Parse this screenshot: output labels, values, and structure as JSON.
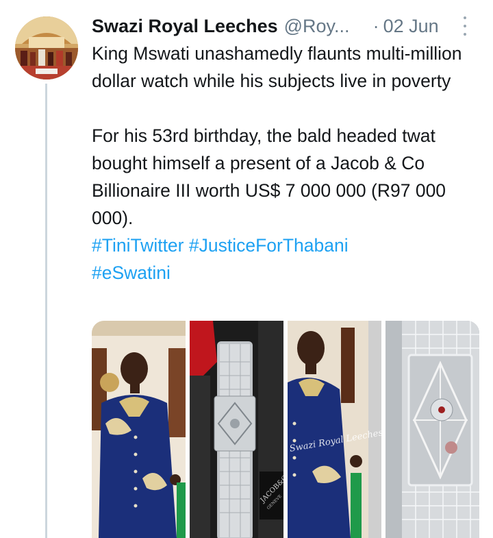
{
  "tweet": {
    "display_name": "Swazi Royal Leeches",
    "handle": "@Roy...",
    "separator": "·",
    "date": "02 Jun",
    "paragraph1": "King Mswati unashamedly flaunts multi-million dollar watch while his subjects live in poverty",
    "paragraph2": "For his 53rd birthday, the bald headed twat bought himself a present of a Jacob & Co Billionaire III  worth US$ 7 000 000 (R97 000 000).",
    "hashtags": [
      "#TiniTwitter",
      "#JusticeForThabani",
      "#eSwatini"
    ]
  },
  "media": {
    "watermark": "Swazi Royal Leeches",
    "watch_box_label": "JACOB&C",
    "watch_box_sublabel": "GENEVE"
  },
  "colors": {
    "link": "#1da1f2",
    "text": "#14171a",
    "secondary": "#657786",
    "thread_line": "#ccd6dd",
    "suit_blue": "#1b2f7a",
    "gold": "#d8c07a"
  },
  "icons": [
    "more-options-icon"
  ]
}
